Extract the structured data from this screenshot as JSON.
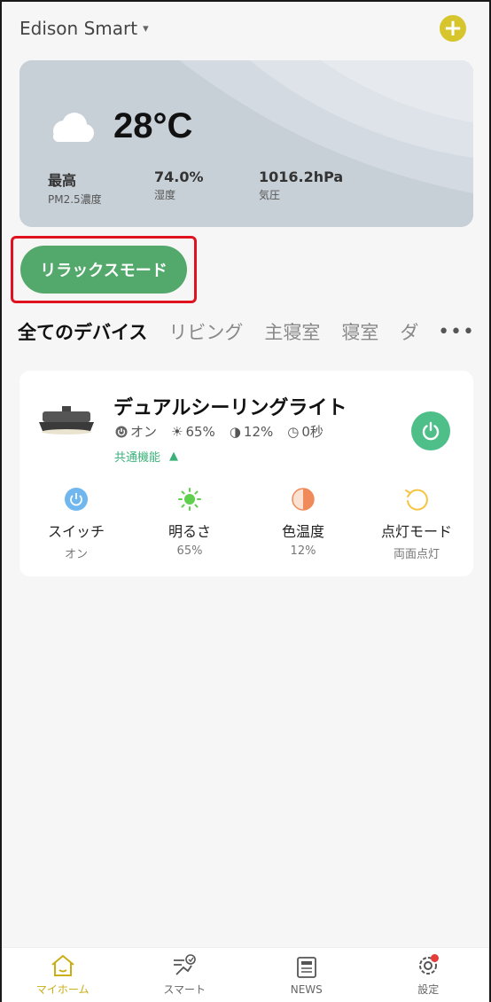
{
  "header": {
    "home_name": "Edison Smart",
    "caret": "▾",
    "add_label": "+"
  },
  "weather": {
    "temperature": "28°C",
    "stats": [
      {
        "value": "最高",
        "label": "PM2.5濃度"
      },
      {
        "value": "74.0%",
        "label": "湿度"
      },
      {
        "value": "1016.2hPa",
        "label": "気圧"
      }
    ]
  },
  "scene": {
    "label": "リラックスモード"
  },
  "tabs": {
    "items": [
      "全てのデバイス",
      "リビング",
      "主寝室",
      "寝室",
      "ダ"
    ],
    "active_index": 0,
    "more_label": "•••"
  },
  "device": {
    "name": "デュアルシーリングライト",
    "status": {
      "power": "オン",
      "brightness": "65%",
      "color_temp": "12%",
      "timer": "0秒"
    },
    "common_label": "共通機能",
    "functions": [
      {
        "name": "スイッチ",
        "value": "オン",
        "icon": "power-icon"
      },
      {
        "name": "明るさ",
        "value": "65%",
        "icon": "brightness-icon"
      },
      {
        "name": "色温度",
        "value": "12%",
        "icon": "color-temperature-icon"
      },
      {
        "name": "点灯モード",
        "value": "両面点灯",
        "icon": "mode-icon"
      }
    ]
  },
  "nav": {
    "items": [
      {
        "label": "マイホーム",
        "icon": "home-icon",
        "active": true
      },
      {
        "label": "スマート",
        "icon": "smart-icon",
        "active": false
      },
      {
        "label": "NEWS",
        "icon": "news-icon",
        "active": false
      },
      {
        "label": "設定",
        "icon": "settings-icon",
        "active": false
      }
    ]
  },
  "colors": {
    "accent": "#d6c52c",
    "scene_green": "#53a96b",
    "power_green": "#4fbf8a",
    "highlight_red": "#e0121f",
    "nav_active": "#c9ae14"
  }
}
